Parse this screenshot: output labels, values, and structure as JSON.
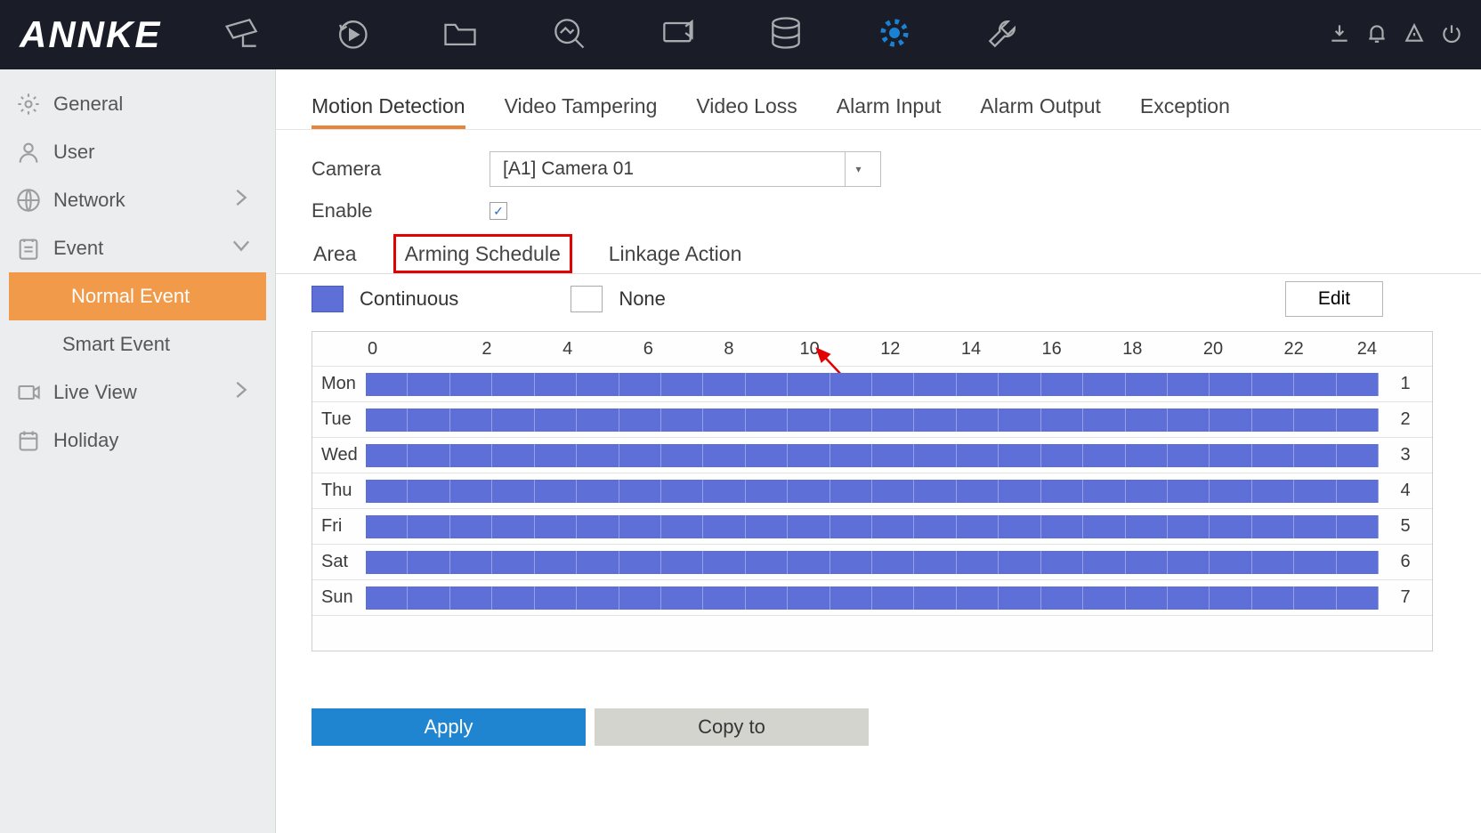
{
  "brand": "ANNKE",
  "sidebar": {
    "items": [
      {
        "label": "General"
      },
      {
        "label": "User"
      },
      {
        "label": "Network"
      },
      {
        "label": "Event"
      },
      {
        "label": "Live View"
      },
      {
        "label": "Holiday"
      }
    ],
    "sub": {
      "normal": "Normal Event",
      "smart": "Smart Event"
    }
  },
  "tabs": {
    "items": [
      "Motion Detection",
      "Video Tampering",
      "Video Loss",
      "Alarm Input",
      "Alarm Output",
      "Exception"
    ],
    "active": "Motion Detection"
  },
  "camera": {
    "label": "Camera",
    "value": "[A1] Camera 01"
  },
  "enable": {
    "label": "Enable",
    "checked": true
  },
  "subtabs": {
    "items": [
      "Area",
      "Arming Schedule",
      "Linkage Action"
    ],
    "active": "Arming Schedule"
  },
  "legend": {
    "continuous": "Continuous",
    "none": "None",
    "edit": "Edit"
  },
  "schedule": {
    "hours": [
      "0",
      "2",
      "4",
      "6",
      "8",
      "10",
      "12",
      "14",
      "16",
      "18",
      "20",
      "22",
      "24"
    ],
    "days": [
      {
        "name": "Mon",
        "num": "1",
        "start": 0,
        "end": 24
      },
      {
        "name": "Tue",
        "num": "2",
        "start": 0,
        "end": 24
      },
      {
        "name": "Wed",
        "num": "3",
        "start": 0,
        "end": 24
      },
      {
        "name": "Thu",
        "num": "4",
        "start": 0,
        "end": 24
      },
      {
        "name": "Fri",
        "num": "5",
        "start": 0,
        "end": 24
      },
      {
        "name": "Sat",
        "num": "6",
        "start": 0,
        "end": 24
      },
      {
        "name": "Sun",
        "num": "7",
        "start": 0,
        "end": 24
      }
    ]
  },
  "buttons": {
    "apply": "Apply",
    "copy": "Copy to"
  },
  "colors": {
    "continuous": "#5e6fd7",
    "accent_orange": "#f09a4a",
    "tab_underline": "#e7863b",
    "primary_blue": "#2085d0",
    "highlight_red": "#e30000"
  }
}
